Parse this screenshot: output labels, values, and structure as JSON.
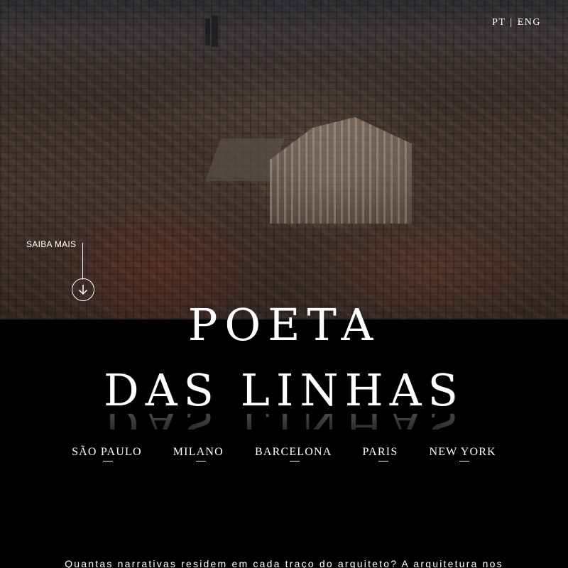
{
  "header": {
    "lang_pt": "PT",
    "lang_separator": "|",
    "lang_eng": "ENG"
  },
  "hero": {
    "saiba_mais": "SAIBA MAIS",
    "arrow_icon": "arrow-down-circle-icon"
  },
  "title": {
    "line1": "POETA",
    "line2": "DAS LINHAS"
  },
  "cities": [
    "SÃO PAULO",
    "MILANO",
    "BARCELONA",
    "PARIS",
    "NEW YORK"
  ],
  "intro": {
    "text": "Quantas narrativas residem em cada traço do arquiteto? A arquitetura nos"
  },
  "colors": {
    "background": "#000000",
    "text": "#ffffff"
  }
}
